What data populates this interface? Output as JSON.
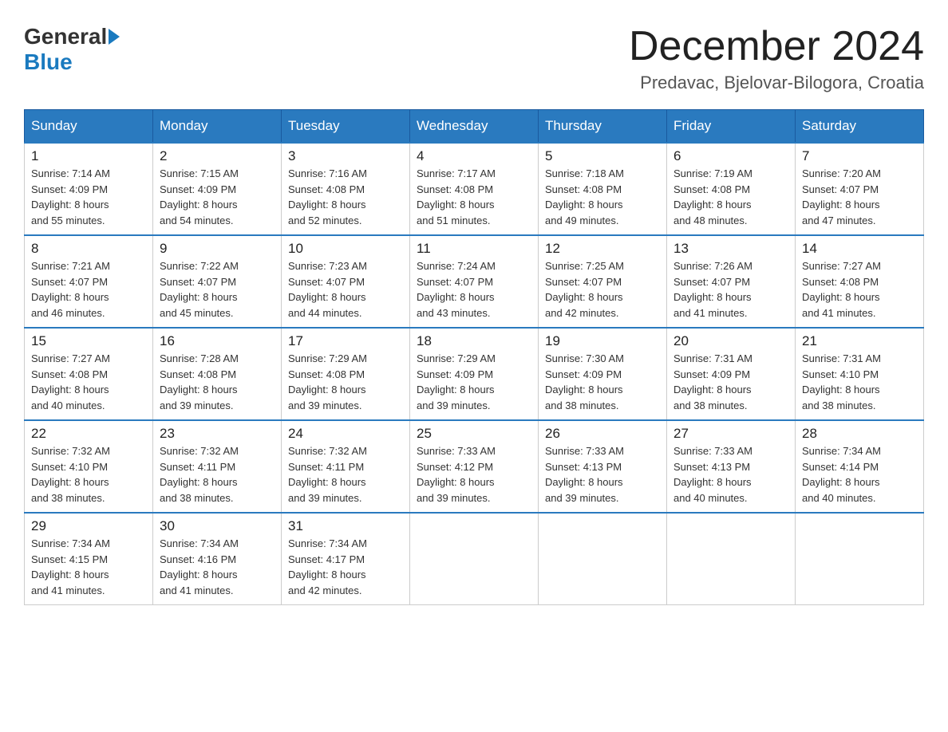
{
  "header": {
    "logo_general": "General",
    "logo_blue": "Blue",
    "month_title": "December 2024",
    "location": "Predavac, Bjelovar-Bilogora, Croatia"
  },
  "days_of_week": [
    "Sunday",
    "Monday",
    "Tuesday",
    "Wednesday",
    "Thursday",
    "Friday",
    "Saturday"
  ],
  "weeks": [
    [
      {
        "day": "1",
        "sunrise": "7:14 AM",
        "sunset": "4:09 PM",
        "daylight": "8 hours and 55 minutes."
      },
      {
        "day": "2",
        "sunrise": "7:15 AM",
        "sunset": "4:09 PM",
        "daylight": "8 hours and 54 minutes."
      },
      {
        "day": "3",
        "sunrise": "7:16 AM",
        "sunset": "4:08 PM",
        "daylight": "8 hours and 52 minutes."
      },
      {
        "day": "4",
        "sunrise": "7:17 AM",
        "sunset": "4:08 PM",
        "daylight": "8 hours and 51 minutes."
      },
      {
        "day": "5",
        "sunrise": "7:18 AM",
        "sunset": "4:08 PM",
        "daylight": "8 hours and 49 minutes."
      },
      {
        "day": "6",
        "sunrise": "7:19 AM",
        "sunset": "4:08 PM",
        "daylight": "8 hours and 48 minutes."
      },
      {
        "day": "7",
        "sunrise": "7:20 AM",
        "sunset": "4:07 PM",
        "daylight": "8 hours and 47 minutes."
      }
    ],
    [
      {
        "day": "8",
        "sunrise": "7:21 AM",
        "sunset": "4:07 PM",
        "daylight": "8 hours and 46 minutes."
      },
      {
        "day": "9",
        "sunrise": "7:22 AM",
        "sunset": "4:07 PM",
        "daylight": "8 hours and 45 minutes."
      },
      {
        "day": "10",
        "sunrise": "7:23 AM",
        "sunset": "4:07 PM",
        "daylight": "8 hours and 44 minutes."
      },
      {
        "day": "11",
        "sunrise": "7:24 AM",
        "sunset": "4:07 PM",
        "daylight": "8 hours and 43 minutes."
      },
      {
        "day": "12",
        "sunrise": "7:25 AM",
        "sunset": "4:07 PM",
        "daylight": "8 hours and 42 minutes."
      },
      {
        "day": "13",
        "sunrise": "7:26 AM",
        "sunset": "4:07 PM",
        "daylight": "8 hours and 41 minutes."
      },
      {
        "day": "14",
        "sunrise": "7:27 AM",
        "sunset": "4:08 PM",
        "daylight": "8 hours and 41 minutes."
      }
    ],
    [
      {
        "day": "15",
        "sunrise": "7:27 AM",
        "sunset": "4:08 PM",
        "daylight": "8 hours and 40 minutes."
      },
      {
        "day": "16",
        "sunrise": "7:28 AM",
        "sunset": "4:08 PM",
        "daylight": "8 hours and 39 minutes."
      },
      {
        "day": "17",
        "sunrise": "7:29 AM",
        "sunset": "4:08 PM",
        "daylight": "8 hours and 39 minutes."
      },
      {
        "day": "18",
        "sunrise": "7:29 AM",
        "sunset": "4:09 PM",
        "daylight": "8 hours and 39 minutes."
      },
      {
        "day": "19",
        "sunrise": "7:30 AM",
        "sunset": "4:09 PM",
        "daylight": "8 hours and 38 minutes."
      },
      {
        "day": "20",
        "sunrise": "7:31 AM",
        "sunset": "4:09 PM",
        "daylight": "8 hours and 38 minutes."
      },
      {
        "day": "21",
        "sunrise": "7:31 AM",
        "sunset": "4:10 PM",
        "daylight": "8 hours and 38 minutes."
      }
    ],
    [
      {
        "day": "22",
        "sunrise": "7:32 AM",
        "sunset": "4:10 PM",
        "daylight": "8 hours and 38 minutes."
      },
      {
        "day": "23",
        "sunrise": "7:32 AM",
        "sunset": "4:11 PM",
        "daylight": "8 hours and 38 minutes."
      },
      {
        "day": "24",
        "sunrise": "7:32 AM",
        "sunset": "4:11 PM",
        "daylight": "8 hours and 39 minutes."
      },
      {
        "day": "25",
        "sunrise": "7:33 AM",
        "sunset": "4:12 PM",
        "daylight": "8 hours and 39 minutes."
      },
      {
        "day": "26",
        "sunrise": "7:33 AM",
        "sunset": "4:13 PM",
        "daylight": "8 hours and 39 minutes."
      },
      {
        "day": "27",
        "sunrise": "7:33 AM",
        "sunset": "4:13 PM",
        "daylight": "8 hours and 40 minutes."
      },
      {
        "day": "28",
        "sunrise": "7:34 AM",
        "sunset": "4:14 PM",
        "daylight": "8 hours and 40 minutes."
      }
    ],
    [
      {
        "day": "29",
        "sunrise": "7:34 AM",
        "sunset": "4:15 PM",
        "daylight": "8 hours and 41 minutes."
      },
      {
        "day": "30",
        "sunrise": "7:34 AM",
        "sunset": "4:16 PM",
        "daylight": "8 hours and 41 minutes."
      },
      {
        "day": "31",
        "sunrise": "7:34 AM",
        "sunset": "4:17 PM",
        "daylight": "8 hours and 42 minutes."
      },
      null,
      null,
      null,
      null
    ]
  ]
}
